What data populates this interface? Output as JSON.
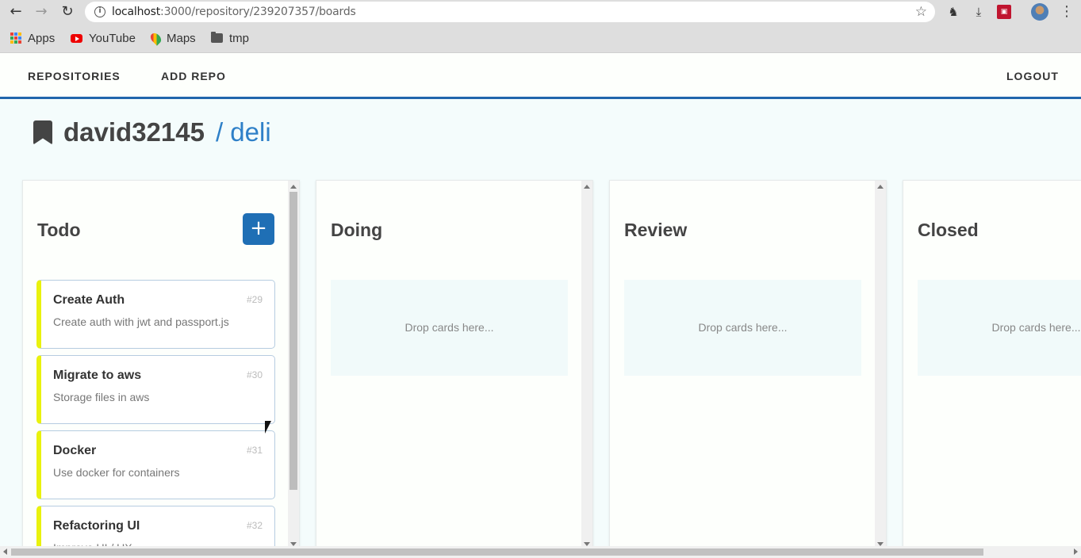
{
  "browser": {
    "url_host": "localhost",
    "url_rest": ":3000/repository/239207357/boards",
    "bookmarks": [
      {
        "label": "Apps",
        "icon": "apps-grid-icon"
      },
      {
        "label": "YouTube",
        "icon": "youtube-icon"
      },
      {
        "label": "Maps",
        "icon": "maps-icon"
      },
      {
        "label": "tmp",
        "icon": "folder-icon"
      }
    ]
  },
  "nav": {
    "repositories": "REPOSITORIES",
    "add_repo": "ADD REPO",
    "logout": "LOGOUT"
  },
  "repo": {
    "owner": "david32145",
    "name": "/ deli"
  },
  "columns": [
    {
      "title": "Todo",
      "add_label": "+",
      "cards": [
        {
          "title": "Create Auth",
          "number": "#29",
          "description": "Create auth with jwt and passport.js"
        },
        {
          "title": "Migrate to aws",
          "number": "#30",
          "description": "Storage files in aws"
        },
        {
          "title": "Docker",
          "number": "#31",
          "description": "Use docker for containers"
        },
        {
          "title": "Refactoring UI",
          "number": "#32",
          "description": "Improve UI / UX"
        }
      ]
    },
    {
      "title": "Doing",
      "drop_text": "Drop cards here..."
    },
    {
      "title": "Review",
      "drop_text": "Drop cards here..."
    },
    {
      "title": "Closed",
      "drop_text": "Drop cards here..."
    }
  ],
  "colors": {
    "accent": "#1f6fb5",
    "card_stripe": "#e9f20d",
    "repo_name": "#2f80c8"
  }
}
